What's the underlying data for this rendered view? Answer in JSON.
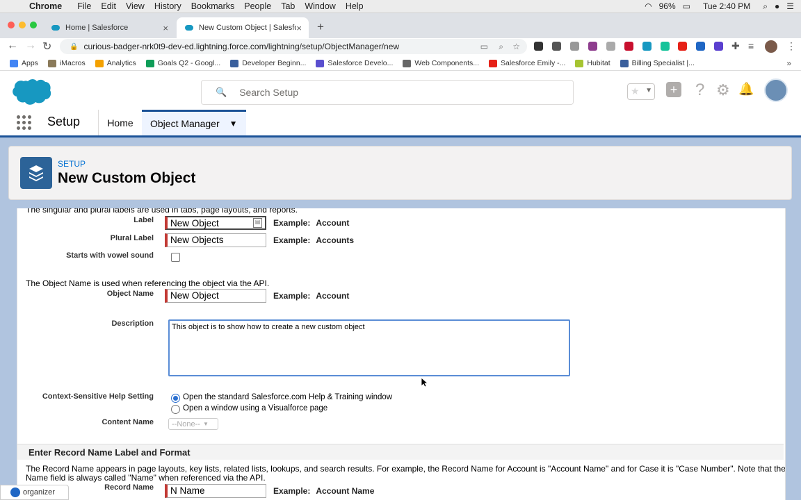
{
  "menubar": {
    "app": "Chrome",
    "items": [
      "File",
      "Edit",
      "View",
      "History",
      "Bookmarks",
      "People",
      "Tab",
      "Window",
      "Help"
    ],
    "battery": "96%",
    "clock": "Tue 2:40 PM"
  },
  "tabs": [
    {
      "title": "Home | Salesforce",
      "close": "×"
    },
    {
      "title": "New Custom Object | Salesfo",
      "close": "×"
    }
  ],
  "new_tab": "+",
  "url": "curious-badger-nrk0t9-dev-ed.lightning.force.com/lightning/setup/ObjectManager/new",
  "bookmarks": [
    {
      "label": "Apps",
      "color": "#4285f4"
    },
    {
      "label": "iMacros",
      "color": "#8a7a5a"
    },
    {
      "label": "Analytics",
      "color": "#f4a100"
    },
    {
      "label": "Goals Q2 - Googl...",
      "color": "#0f9d58"
    },
    {
      "label": "Developer Beginn...",
      "color": "#3a5f9c"
    },
    {
      "label": "Salesforce Develo...",
      "color": "#5a4fcf"
    },
    {
      "label": "Web Components...",
      "color": "#666666"
    },
    {
      "label": "Salesforce Emily -...",
      "color": "#e62117"
    },
    {
      "label": "Hubitat",
      "color": "#a6c431"
    },
    {
      "label": "Billing Specialist |...",
      "color": "#3a5f9c"
    }
  ],
  "search": {
    "placeholder": "Search Setup"
  },
  "nav": {
    "app_name": "Setup",
    "home": "Home",
    "object_manager": "Object Manager"
  },
  "page_header": {
    "breadcrumb": "SETUP",
    "title": "New Custom Object"
  },
  "form": {
    "labels_help": "The singular and plural labels are used in tabs, page layouts, and reports.",
    "label_field": {
      "label": "Label",
      "value": "New Object",
      "example_prefix": "Example:",
      "example": "Account"
    },
    "plural_field": {
      "label": "Plural Label",
      "value": "New Objects",
      "example_prefix": "Example:",
      "example": "Accounts"
    },
    "vowel": {
      "label": "Starts with vowel sound",
      "checked": false
    },
    "object_name_help": "The Object Name is used when referencing the object via the API.",
    "object_name": {
      "label": "Object Name",
      "value": "New Object",
      "example_prefix": "Example:",
      "example": "Account"
    },
    "description": {
      "label": "Description",
      "value": "This object is to show how to create a new custom object"
    },
    "help_setting": {
      "label": "Context-Sensitive Help Setting",
      "option1": "Open the standard Salesforce.com Help & Training window",
      "option2": "Open a window using a Visualforce page",
      "selected": 1
    },
    "content_name": {
      "label": "Content Name",
      "value": "--None--"
    },
    "record_section": {
      "title": "Enter Record Name Label and Format",
      "help_line1": "The Record Name appears in page layouts, key lists, related lists, lookups, and search results. For example, the Record Name for Account is \"Account Name\" and for Case it is \"Case Number\". Note that the Record",
      "help_line2": "Name field is always called \"Name\" when referenced via the API.",
      "record_name": {
        "label": "Record Name",
        "value": "N Name",
        "example_prefix": "Example:",
        "example": "Account Name"
      }
    }
  },
  "organizer": "organizer"
}
